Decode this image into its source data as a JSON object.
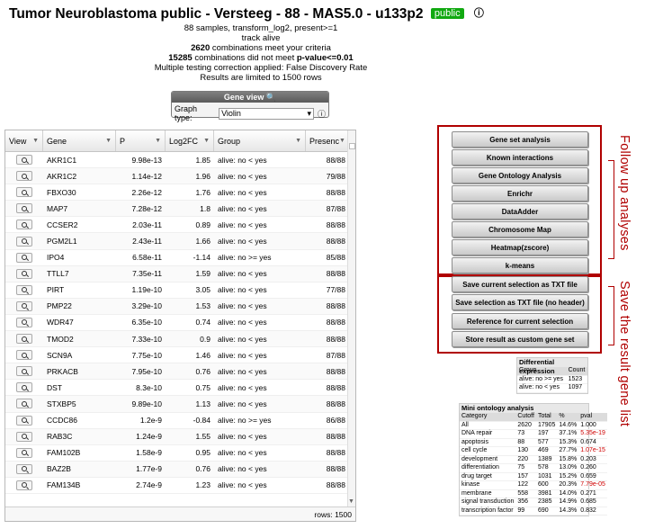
{
  "header": {
    "title": "Tumor Neuroblastoma public - Versteeg - 88 - MAS5.0 - u133p2",
    "badge": "public",
    "info_symbol": "ⓘ"
  },
  "summary": {
    "line1": "88 samples, transform_log2, present>=1",
    "line2": "track alive",
    "line3_num": "2620",
    "line3_text": " combinations meet your criteria",
    "line4_num": "15285",
    "line4_text": " combinations did not meet ",
    "line4_bold": "p-value<=0.01",
    "line5": "Multiple testing correction applied: False Discovery Rate",
    "line6": "Results are limited to 1500 rows"
  },
  "gene_view": {
    "title": "Gene view",
    "label": "Graph type:",
    "selected": "Violin"
  },
  "grid": {
    "columns": [
      "View",
      "Gene",
      "P",
      "Log2FC",
      "Group",
      "Presenc"
    ],
    "rows": [
      [
        "AKR1C1",
        "9.98e-13",
        "1.85",
        "alive: no < yes",
        "88/88"
      ],
      [
        "AKR1C2",
        "1.14e-12",
        "1.96",
        "alive: no < yes",
        "79/88"
      ],
      [
        "FBXO30",
        "2.26e-12",
        "1.76",
        "alive: no < yes",
        "88/88"
      ],
      [
        "MAP7",
        "7.28e-12",
        "1.8",
        "alive: no < yes",
        "87/88"
      ],
      [
        "CCSER2",
        "2.03e-11",
        "0.89",
        "alive: no < yes",
        "88/88"
      ],
      [
        "PGM2L1",
        "2.43e-11",
        "1.66",
        "alive: no < yes",
        "88/88"
      ],
      [
        "IPO4",
        "6.58e-11",
        "-1.14",
        "alive: no >= yes",
        "85/88"
      ],
      [
        "TTLL7",
        "7.35e-11",
        "1.59",
        "alive: no < yes",
        "88/88"
      ],
      [
        "PIRT",
        "1.19e-10",
        "3.05",
        "alive: no < yes",
        "77/88"
      ],
      [
        "PMP22",
        "3.29e-10",
        "1.53",
        "alive: no < yes",
        "88/88"
      ],
      [
        "WDR47",
        "6.35e-10",
        "0.74",
        "alive: no < yes",
        "88/88"
      ],
      [
        "TMOD2",
        "7.33e-10",
        "0.9",
        "alive: no < yes",
        "88/88"
      ],
      [
        "SCN9A",
        "7.75e-10",
        "1.46",
        "alive: no < yes",
        "87/88"
      ],
      [
        "PRKACB",
        "7.95e-10",
        "0.76",
        "alive: no < yes",
        "88/88"
      ],
      [
        "DST",
        "8.3e-10",
        "0.75",
        "alive: no < yes",
        "88/88"
      ],
      [
        "STXBP5",
        "9.89e-10",
        "1.13",
        "alive: no < yes",
        "88/88"
      ],
      [
        "CCDC86",
        "1.2e-9",
        "-0.84",
        "alive: no >= yes",
        "86/88"
      ],
      [
        "RAB3C",
        "1.24e-9",
        "1.55",
        "alive: no < yes",
        "88/88"
      ],
      [
        "FAM102B",
        "1.58e-9",
        "0.95",
        "alive: no < yes",
        "88/88"
      ],
      [
        "BAZ2B",
        "1.77e-9",
        "0.76",
        "alive: no < yes",
        "88/88"
      ],
      [
        "FAM134B",
        "2.74e-9",
        "1.23",
        "alive: no < yes",
        "88/88"
      ]
    ],
    "footer": "rows: 1500"
  },
  "followup_buttons": [
    "Gene set analysis",
    "Known interactions",
    "Gene Ontology Analysis",
    "Enrichr",
    "DataAdder",
    "Chromosome Map",
    "Heatmap(zscore)",
    "k-means"
  ],
  "save_buttons": [
    "Save current selection as TXT file",
    "Save selection as TXT file (no header)",
    "Reference for current selection",
    "Store result as custom gene set"
  ],
  "annotations": {
    "followup": "Follow up analyses",
    "save": "Save the result gene list"
  },
  "diff_expr": {
    "title": "Differential expression",
    "headers": [
      "Group",
      "Count"
    ],
    "rows": [
      [
        "alive: no >= yes",
        "1523"
      ],
      [
        "alive: no < yes",
        "1097"
      ]
    ]
  },
  "mini_ontology": {
    "title": "Mini ontology analysis",
    "headers": [
      "Category",
      "Cutoff",
      "Total",
      "%",
      "pval"
    ],
    "rows": [
      [
        "All",
        "2620",
        "17905",
        "14.6%",
        "1.000",
        false
      ],
      [
        "DNA repair",
        "73",
        "197",
        "37.1%",
        "5.35e-19",
        true
      ],
      [
        "apoptosis",
        "88",
        "577",
        "15.3%",
        "0.674",
        false
      ],
      [
        "cell cycle",
        "130",
        "469",
        "27.7%",
        "1.07e-15",
        true
      ],
      [
        "development",
        "220",
        "1389",
        "15.8%",
        "0.203",
        false
      ],
      [
        "differentiation",
        "75",
        "578",
        "13.0%",
        "0.260",
        false
      ],
      [
        "drug target",
        "157",
        "1031",
        "15.2%",
        "0.659",
        false
      ],
      [
        "kinase",
        "122",
        "600",
        "20.3%",
        "7.79e-05",
        true
      ],
      [
        "membrane",
        "558",
        "3981",
        "14.0%",
        "0.271",
        false
      ],
      [
        "signal transduction",
        "356",
        "2385",
        "14.9%",
        "0.685",
        false
      ],
      [
        "transcription factor",
        "99",
        "690",
        "14.3%",
        "0.832",
        false
      ]
    ]
  },
  "colors": {
    "accent_red": "#b00000",
    "badge_green": "#11a911",
    "pval_red": "#d00000"
  }
}
